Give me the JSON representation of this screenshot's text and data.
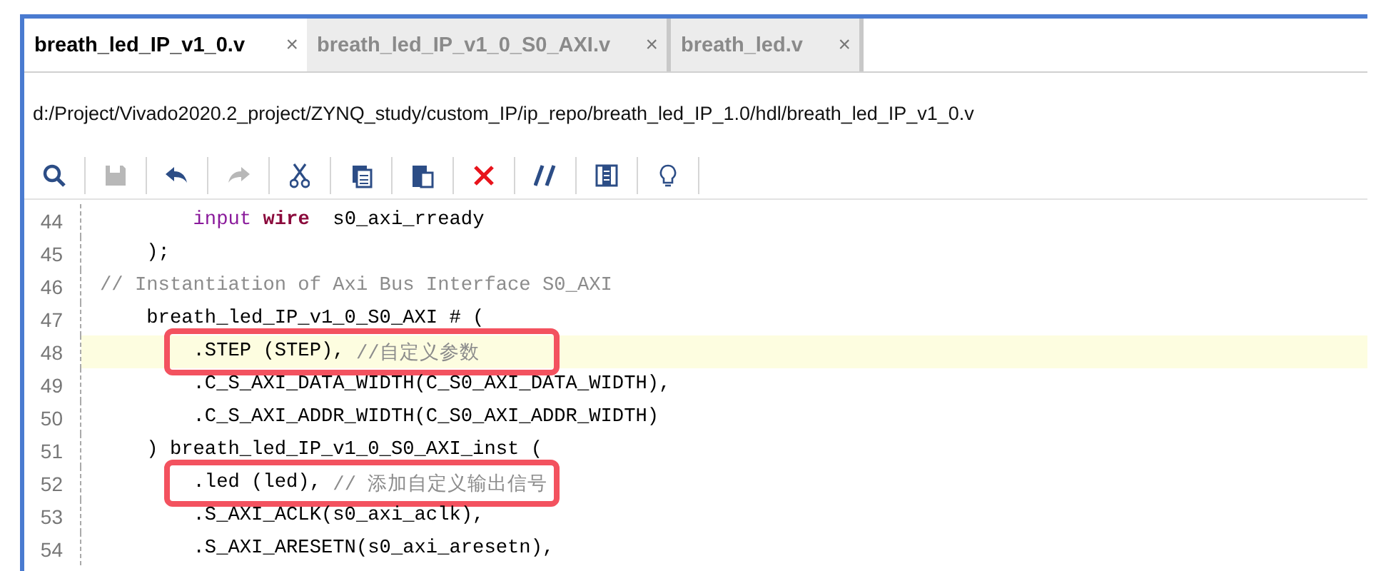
{
  "tabs": [
    {
      "label": "breath_led_IP_v1_0.v",
      "selected": true,
      "close": "×"
    },
    {
      "label": "breath_led_IP_v1_0_S0_AXI.v",
      "selected": false,
      "close": "×"
    },
    {
      "label": "breath_led.v",
      "selected": false,
      "close": "×"
    }
  ],
  "file_path": "d:/Project/Vivado2020.2_project/ZYNQ_study/custom_IP/ip_repo/breath_led_IP_1.0/hdl/breath_led_IP_v1_0.v",
  "toolbar": [
    {
      "kind": "search",
      "disabled": false
    },
    {
      "kind": "save",
      "disabled": true
    },
    {
      "kind": "undo",
      "disabled": false
    },
    {
      "kind": "redo",
      "disabled": true
    },
    {
      "kind": "cut",
      "disabled": false
    },
    {
      "kind": "copy",
      "disabled": false
    },
    {
      "kind": "paste",
      "disabled": false
    },
    {
      "kind": "delete",
      "disabled": false
    },
    {
      "kind": "comment",
      "disabled": false
    },
    {
      "kind": "columns",
      "disabled": false
    },
    {
      "kind": "hint",
      "disabled": false
    }
  ],
  "lines": [
    {
      "number": "44",
      "current": false,
      "annotated": false,
      "tokens": [
        {
          "kind": "keyword",
          "text": "        input"
        },
        {
          "kind": "type",
          "text": " wire"
        },
        {
          "kind": "plain",
          "text": "  s0_axi_rready"
        }
      ]
    },
    {
      "number": "45",
      "current": false,
      "annotated": false,
      "tokens": [
        {
          "kind": "plain",
          "text": "    );"
        }
      ]
    },
    {
      "number": "46",
      "current": false,
      "annotated": false,
      "tokens": [
        {
          "kind": "comment",
          "text": "// Instantiation of Axi Bus Interface S0_AXI"
        }
      ]
    },
    {
      "number": "47",
      "current": false,
      "annotated": false,
      "tokens": [
        {
          "kind": "plain",
          "text": "    breath_led_IP_v1_0_S0_AXI # ("
        }
      ]
    },
    {
      "number": "48",
      "current": true,
      "annotated": true,
      "tokens": [
        {
          "kind": "plain",
          "text": "        .STEP (STEP), "
        },
        {
          "kind": "comment",
          "text": "//自定义参数"
        }
      ]
    },
    {
      "number": "49",
      "current": false,
      "annotated": false,
      "tokens": [
        {
          "kind": "plain",
          "text": "        .C_S_AXI_DATA_WIDTH(C_S0_AXI_DATA_WIDTH),"
        }
      ]
    },
    {
      "number": "50",
      "current": false,
      "annotated": false,
      "tokens": [
        {
          "kind": "plain",
          "text": "        .C_S_AXI_ADDR_WIDTH(C_S0_AXI_ADDR_WIDTH)"
        }
      ]
    },
    {
      "number": "51",
      "current": false,
      "annotated": false,
      "tokens": [
        {
          "kind": "plain",
          "text": "    ) breath_led_IP_v1_0_S0_AXI_inst ("
        }
      ]
    },
    {
      "number": "52",
      "current": false,
      "annotated": true,
      "tokens": [
        {
          "kind": "plain",
          "text": "        .led (led), "
        },
        {
          "kind": "comment",
          "text": "// 添加自定义输出信号"
        }
      ]
    },
    {
      "number": "53",
      "current": false,
      "annotated": false,
      "tokens": [
        {
          "kind": "plain",
          "text": "        .S_AXI_ACLK(s0_axi_aclk),"
        }
      ]
    },
    {
      "number": "54",
      "current": false,
      "annotated": false,
      "tokens": [
        {
          "kind": "plain",
          "text": "        .S_AXI_ARESETN(s0_axi_aresetn),"
        }
      ]
    }
  ]
}
